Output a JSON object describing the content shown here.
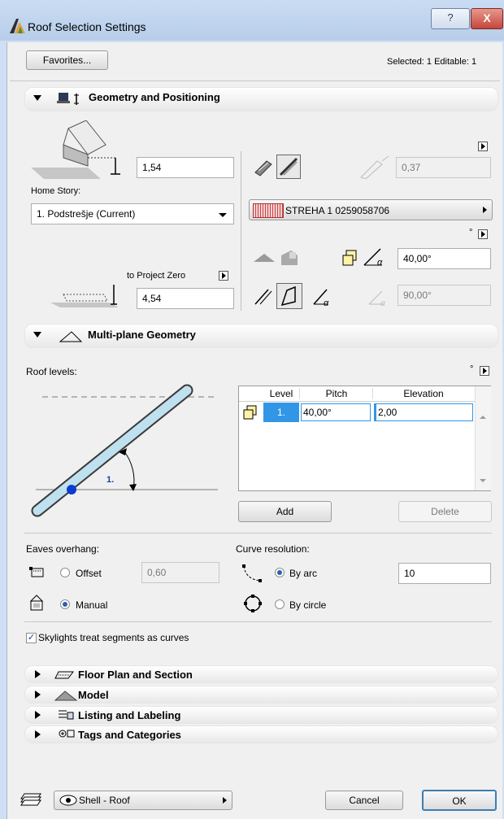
{
  "window": {
    "title": "Roof Selection Settings",
    "help": "?",
    "close": "X"
  },
  "top": {
    "favorites": "Favorites...",
    "selected": "Selected: 1 Editable: 1"
  },
  "geometry": {
    "header": "Geometry and Positioning",
    "height_value": "1,54",
    "home_story_label": "Home Story:",
    "home_story_value": "1. Podstrešje (Current)",
    "offset_value": "0,37",
    "material_value": "STREHA 1 0259058706",
    "to_project_zero_label": "to Project Zero",
    "zero_value": "4,54",
    "pitch_value": "40,00°",
    "angle_value": "90,00°",
    "degree_mark": "°"
  },
  "multiplane": {
    "header": "Multi-plane Geometry",
    "roof_levels_label": "Roof levels:",
    "diagram_level_label": "1.",
    "degree_mark": "°",
    "table": {
      "headers": [
        "Level",
        "Pitch",
        "Elevation"
      ],
      "rows": [
        {
          "level": "1.",
          "pitch": "40,00°",
          "elevation": "2,00"
        }
      ]
    },
    "add": "Add",
    "delete": "Delete",
    "eaves_label": "Eaves overhang:",
    "offset_option": "Offset",
    "offset_value": "0,60",
    "manual_option": "Manual",
    "curve_label": "Curve resolution:",
    "by_arc": "By arc",
    "by_circle": "By circle",
    "arc_value": "10",
    "skylights": "Skylights treat segments as curves"
  },
  "collapsed_sections": [
    {
      "label": "Floor Plan and Section"
    },
    {
      "label": "Model"
    },
    {
      "label": "Listing and Labeling"
    },
    {
      "label": "Tags and Categories"
    }
  ],
  "bottom": {
    "layer": "Shell - Roof",
    "cancel": "Cancel",
    "ok": "OK"
  }
}
